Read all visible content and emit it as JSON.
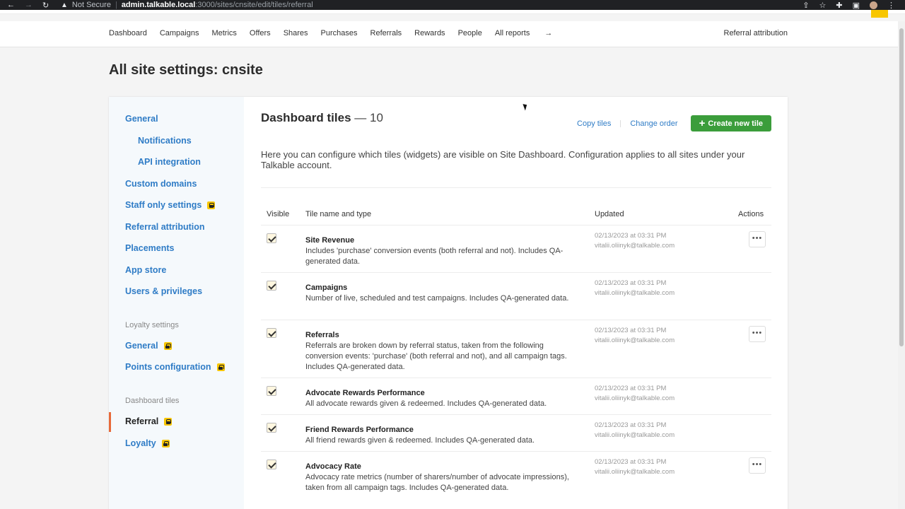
{
  "browser": {
    "security_label": "Not Secure",
    "url_host": "admin.talkable.local",
    "url_path": ":3000/sites/cnsite/edit/tiles/referral"
  },
  "topnav": {
    "links": [
      "Dashboard",
      "Campaigns",
      "Metrics",
      "Offers",
      "Shares",
      "Purchases",
      "Referrals",
      "Rewards",
      "People",
      "All reports"
    ],
    "all_reports_arrow": "→",
    "right_link": "Referral attribution"
  },
  "page_title": "All site settings: cnsite",
  "sidebar": {
    "general": "General",
    "notifications": "Notifications",
    "api_integration": "API integration",
    "custom_domains": "Custom domains",
    "staff_only": "Staff only settings",
    "referral_attribution": "Referral attribution",
    "placements": "Placements",
    "app_store": "App store",
    "users_privileges": "Users & privileges",
    "loyalty_heading": "Loyalty settings",
    "loyalty_general": "General",
    "points_configuration": "Points configuration",
    "dashboard_heading": "Dashboard tiles",
    "referral": "Referral",
    "loyalty": "Loyalty"
  },
  "main": {
    "title": "Dashboard tiles",
    "count": "— 10",
    "copy_tiles": "Copy tiles",
    "change_order": "Change order",
    "create_button": "Create new tile",
    "create_plus": "+",
    "description": "Here you can configure which tiles (widgets) are visible on Site Dashboard. Configuration applies to all sites under your Talkable account.",
    "columns": {
      "visible": "Visible",
      "name": "Tile name and type",
      "updated": "Updated",
      "actions": "Actions"
    },
    "rows": [
      {
        "name": "Site Revenue",
        "desc": "Includes 'purchase' conversion events (both referral and not). Includes QA-generated data.",
        "date": "02/13/2023 at 03:31 PM",
        "user": "vitalii.oliinyk@talkable.com",
        "has_menu": true
      },
      {
        "name": "Campaigns",
        "desc": "Number of live, scheduled and test campaigns. Includes QA-generated data.",
        "date": "02/13/2023 at 03:31 PM",
        "user": "vitalii.oliinyk@talkable.com",
        "has_menu": false
      },
      {
        "name": "Referrals",
        "desc": "Referrals are broken down by referral status, taken from the following conversion events: 'purchase' (both referral and not), and all campaign tags. Includes QA-generated data.",
        "date": "02/13/2023 at 03:31 PM",
        "user": "vitalii.oliinyk@talkable.com",
        "has_menu": true
      },
      {
        "name": "Advocate Rewards Performance",
        "desc": "All advocate rewards given & redeemed. Includes QA-generated data.",
        "date": "02/13/2023 at 03:31 PM",
        "user": "vitalii.oliinyk@talkable.com",
        "has_menu": false
      },
      {
        "name": "Friend Rewards Performance",
        "desc": "All friend rewards given & redeemed. Includes QA-generated data.",
        "date": "02/13/2023 at 03:31 PM",
        "user": "vitalii.oliinyk@talkable.com",
        "has_menu": false
      },
      {
        "name": "Advocacy Rate",
        "desc": "Advocacy rate metrics (number of sharers/number of advocate impressions), taken from all campaign tags. Includes QA-generated data.",
        "date": "02/13/2023 at 03:31 PM",
        "user": "vitalii.oliinyk@talkable.com",
        "has_menu": true
      }
    ],
    "menu_glyph": "•••"
  },
  "colors": {
    "link": "#2f7cc6",
    "create_button": "#3b9d3b",
    "lock_badge": "#f8c600",
    "active_marker": "#e76a3a"
  }
}
